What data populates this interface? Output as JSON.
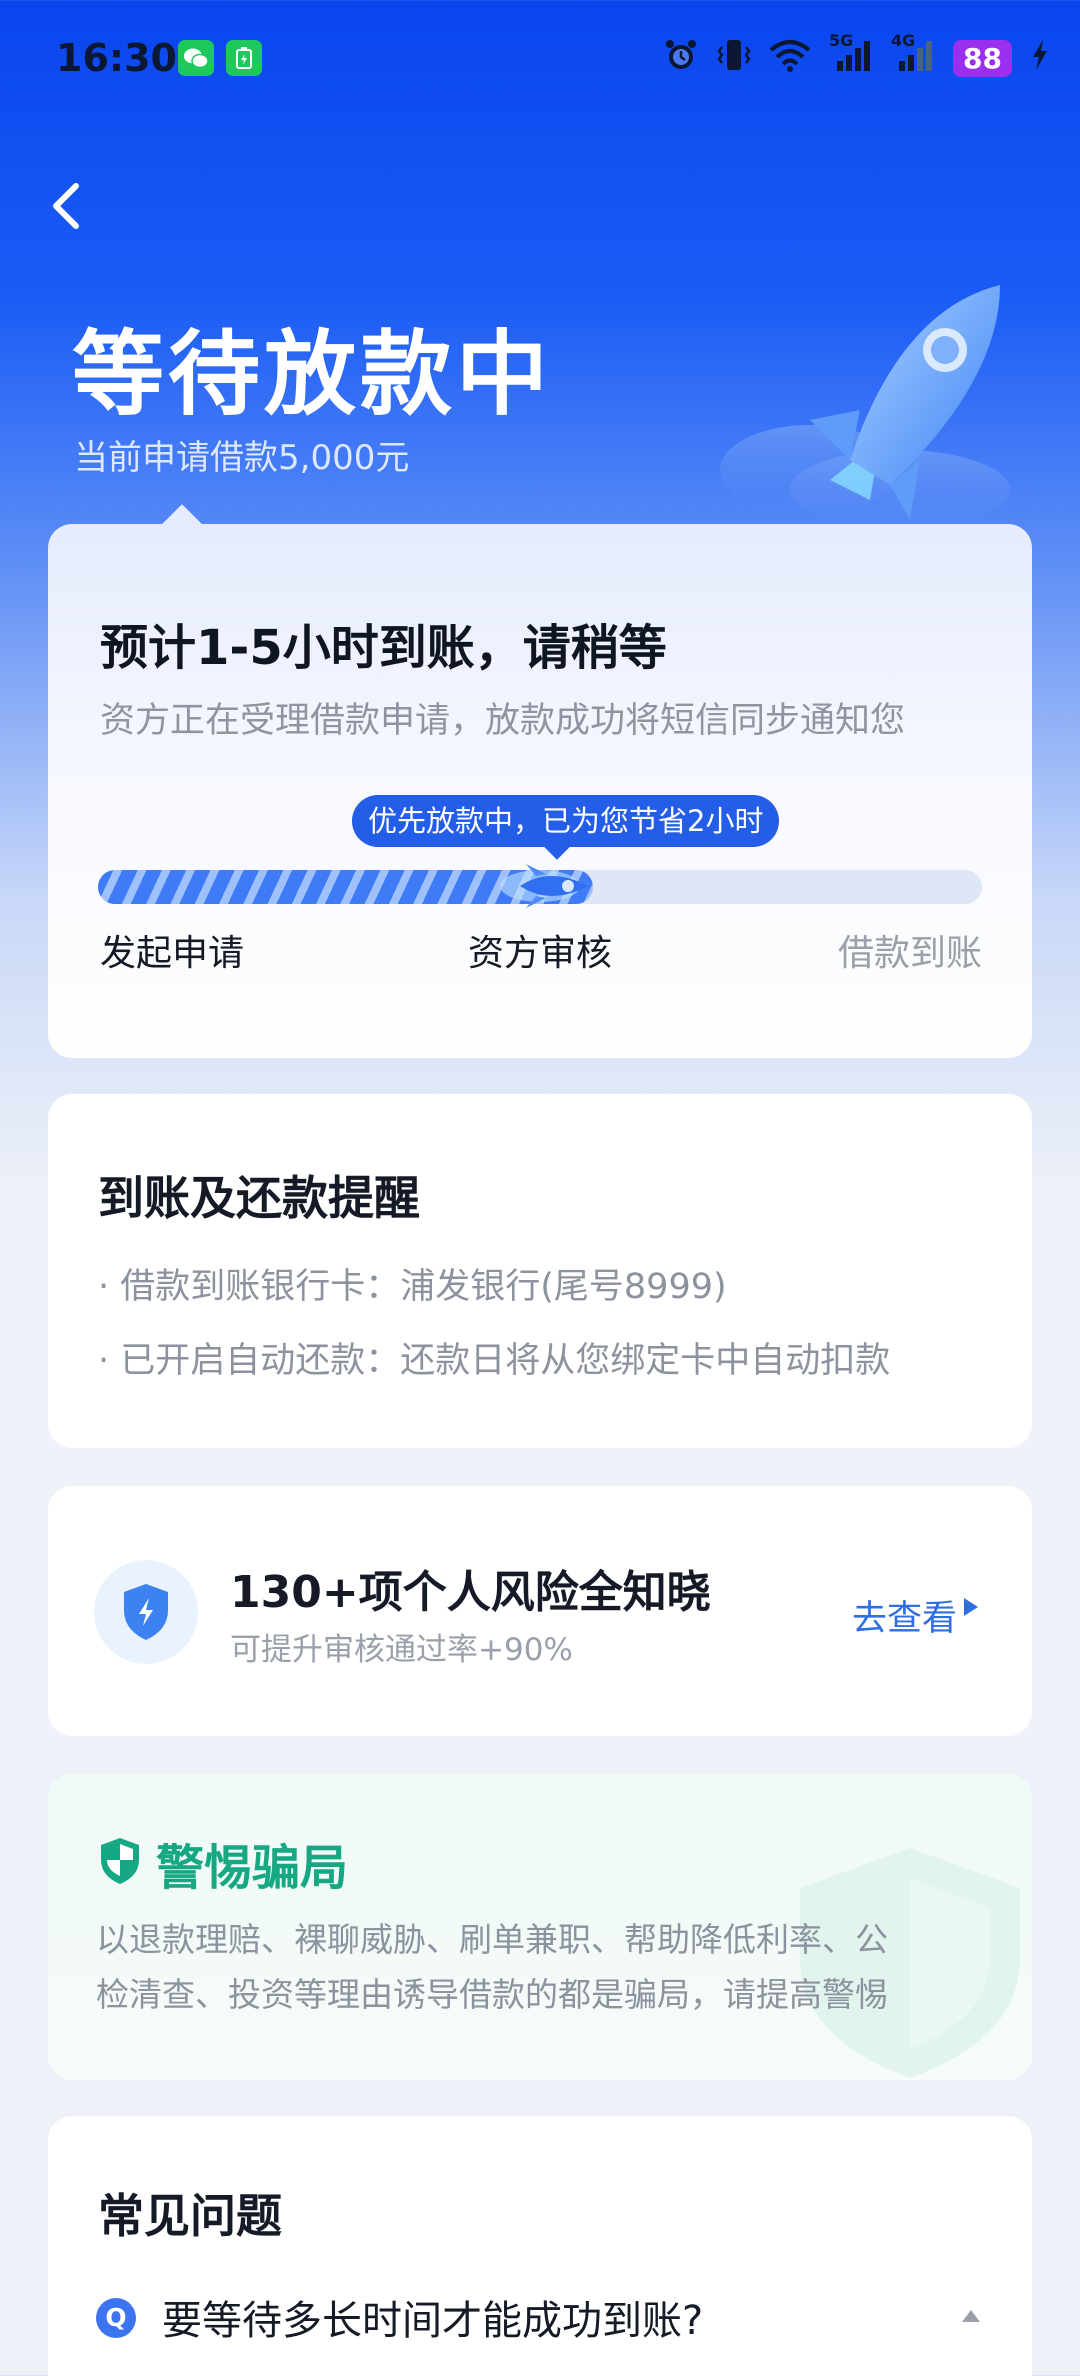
{
  "status_bar": {
    "time": "16:30",
    "battery": "88",
    "network1": "5G",
    "network2": "4G"
  },
  "header": {
    "title": "等待放款中",
    "subtitle": "当前申请借款5,000元"
  },
  "progress_card": {
    "heading": "预计1-5小时到账，请稍等",
    "description": "资方正在受理借款申请，放款成功将短信同步通知您",
    "tip": "优先放款中，已为您节省2小时",
    "progress": 0.56,
    "steps": [
      "发起申请",
      "资方审核",
      "借款到账"
    ]
  },
  "reminder_card": {
    "heading": "到账及还款提醒",
    "items": [
      "· 借款到账银行卡：浦发银行(尾号8999)",
      "· 已开启自动还款：还款日将从您绑定卡中自动扣款"
    ]
  },
  "risk_card": {
    "heading": "130+项个人风险全知晓",
    "subtext": "可提升审核通过率+90%",
    "link": "去查看"
  },
  "fraud_card": {
    "heading": "警惕骗局",
    "line1": "以退款理赔、裸聊威胁、刷单兼职、帮助降低利率、公",
    "line2": "检清查、投资等理由诱导借款的都是骗局，请提高警惕"
  },
  "faq": {
    "heading": "常见问题",
    "q_badge": "Q",
    "question": "要等待多长时间才能成功到账?"
  },
  "colors": {
    "primary_blue": "#245de7",
    "fraud_green": "#16a883"
  }
}
